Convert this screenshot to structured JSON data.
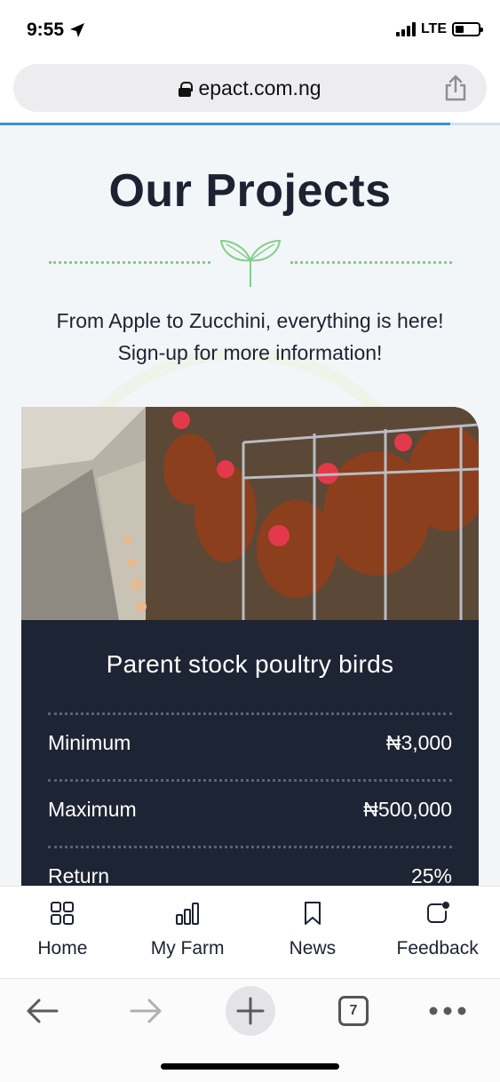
{
  "status": {
    "time": "9:55",
    "network": "LTE"
  },
  "browser": {
    "url": "epact.com.ng",
    "tab_count": "7",
    "load_progress_percent": 90
  },
  "page": {
    "title": "Our Projects",
    "subtitle_line1": "From Apple to Zucchini, everything is here!",
    "subtitle_line2": "Sign-up for more information!",
    "project": {
      "name": "Parent stock poultry birds",
      "rows": [
        {
          "label": "Minimum",
          "value": "₦3,000"
        },
        {
          "label": "Maximum",
          "value": "₦500,000"
        },
        {
          "label": "Return",
          "value": "25%"
        }
      ]
    }
  },
  "app_nav": {
    "items": [
      {
        "label": "Home",
        "icon": "grid-icon"
      },
      {
        "label": "My Farm",
        "icon": "bar-chart-icon"
      },
      {
        "label": "News",
        "icon": "bookmark-icon"
      },
      {
        "label": "Feedback",
        "icon": "feedback-icon"
      }
    ]
  },
  "colors": {
    "accent_green": "#7fcf8a",
    "card_dark": "#1d2433",
    "progress_blue": "#3b8fe0"
  }
}
